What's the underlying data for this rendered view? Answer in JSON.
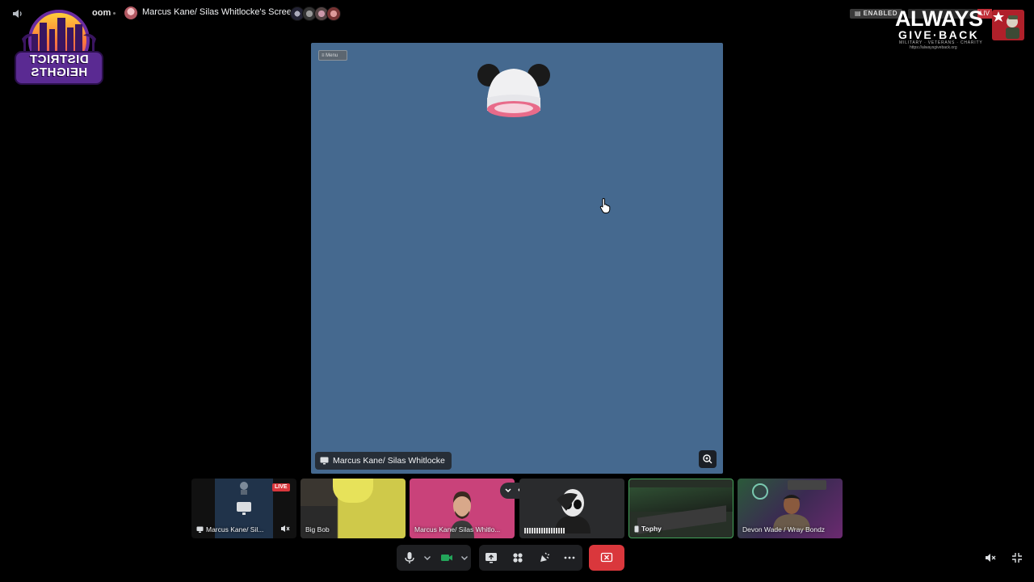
{
  "topbar": {
    "room_fragment": "oom",
    "screen_title": "Marcus Kane/ Silas Whitlocke's Screen",
    "status_badge": "ENABLED",
    "live_label": "LIV"
  },
  "logos": {
    "district_line1": "DISTRICT",
    "district_line2": "HEIGHTS",
    "always_word": "ALWAYS",
    "give_word": "GIVE·BACK",
    "always_tagline": "MILITARY · VETERANS · CHARITY",
    "always_url": "https://alwaysgiveback.org"
  },
  "stage": {
    "menu_label": "≡ Menu",
    "label": "Marcus Kane/ Silas Whitlocke"
  },
  "thumbnails": [
    {
      "label": "Marcus Kane/ Sil...",
      "live": "LIVE",
      "bg": "#20334a"
    },
    {
      "label": "Big Bob",
      "bg": "#cfc94a"
    },
    {
      "label": "Marcus Kane/ Silas Whitlo...",
      "bg": "#c9427a"
    },
    {
      "label": "",
      "bg": "#2a2b2d"
    },
    {
      "label": "Tophy",
      "bg": "#273027"
    },
    {
      "label": "Devon Wade / Wray Bondz",
      "bg": "#3b2a52"
    }
  ],
  "colors": {
    "stage_bg": "#45698f",
    "control_bg": "#1e1f22",
    "end_call": "#da373c",
    "speaking_border": "#43a25a"
  },
  "icons": [
    "volume-icon",
    "mic-icon",
    "camera-icon",
    "screen-share-icon",
    "activities-icon",
    "soundboard-icon",
    "more-icon",
    "end-call-icon",
    "mute-audio-icon",
    "fullscreen-exit-icon",
    "zoom-icon"
  ]
}
